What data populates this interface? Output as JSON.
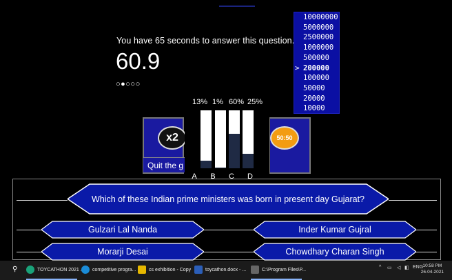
{
  "game": {
    "timer_text": "You have 65 seconds to answer this question.",
    "timer_value": "60.9",
    "progress_dots": "○●○○○"
  },
  "ladder": {
    "items": [
      "10000000",
      "5000000",
      "2500000",
      "1000000",
      "500000",
      "200000",
      "100000",
      "50000",
      "20000",
      "10000"
    ],
    "current_marker": ">"
  },
  "lifelines": {
    "double_dip_label": "x2",
    "fifty_fifty_label": "50:50",
    "quit_label": "Quit the g"
  },
  "poll": {
    "items": [
      {
        "letter": "A",
        "percent_label": "13%",
        "value": 13
      },
      {
        "letter": "B",
        "percent_label": "1%",
        "value": 1
      },
      {
        "letter": "C",
        "percent_label": "60%",
        "value": 60
      },
      {
        "letter": "D",
        "percent_label": "25%",
        "value": 25
      }
    ]
  },
  "question": {
    "text": "Which of these Indian prime ministers was born in present day Gujarat?",
    "options": [
      "Gulzari Lal Nanda",
      "Inder Kumar Gujral",
      "Morarji Desai",
      "Chowdhary Charan Singh"
    ]
  },
  "taskbar": {
    "items": [
      "TOYCATHON 2021 ...",
      "competitive progra...",
      "cs exhibition - Copy",
      "toycathon.docx - ...",
      "C:\\Program Files\\P..."
    ],
    "language": "ENG",
    "time": "10:58 PM",
    "date": "26-04-2021"
  },
  "colors": {
    "accent": "#0b0fa3",
    "option_bg": "#0a1aa8",
    "poll_fill": "#1f2a44"
  }
}
